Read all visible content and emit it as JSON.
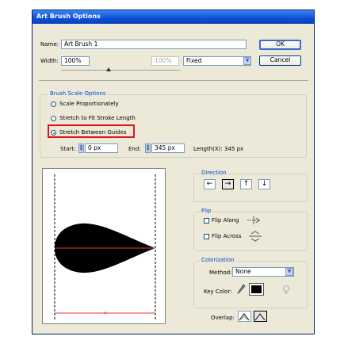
{
  "window": {
    "title": "Art Brush Options"
  },
  "name": {
    "label": "Name:",
    "value": "Art Brush 1"
  },
  "width": {
    "label": "Width:",
    "value": "100%",
    "variation_value": "100%",
    "mode": "Fixed"
  },
  "buttons": {
    "ok": "OK",
    "cancel": "Cancel"
  },
  "scale": {
    "legend": "Brush Scale Options",
    "options": [
      {
        "label": "Scale Proportionately",
        "selected": false
      },
      {
        "label": "Stretch to Fit Stroke Length",
        "selected": false
      },
      {
        "label": "Stretch Between Guides",
        "selected": true
      }
    ],
    "start_label": "Start:",
    "start_value": "0 px",
    "end_label": "End:",
    "end_value": "345 px",
    "length_text": "Length(X): 345 px"
  },
  "direction": {
    "legend": "Direction",
    "arrows": [
      "←",
      "→",
      "↑",
      "↓"
    ],
    "selected_index": 1
  },
  "flip": {
    "legend": "Flip",
    "along_label": "Flip Along",
    "across_label": "Flip Across"
  },
  "colorization": {
    "legend": "Colorization",
    "method_label": "Method:",
    "method_value": "None",
    "key_color_label": "Key Color:",
    "key_color": "#000000"
  },
  "overlap": {
    "label": "Overlap:"
  },
  "colors": {
    "highlight": "#E0141C",
    "guide_red": "#E03A3A",
    "accent": "#0046D5"
  }
}
